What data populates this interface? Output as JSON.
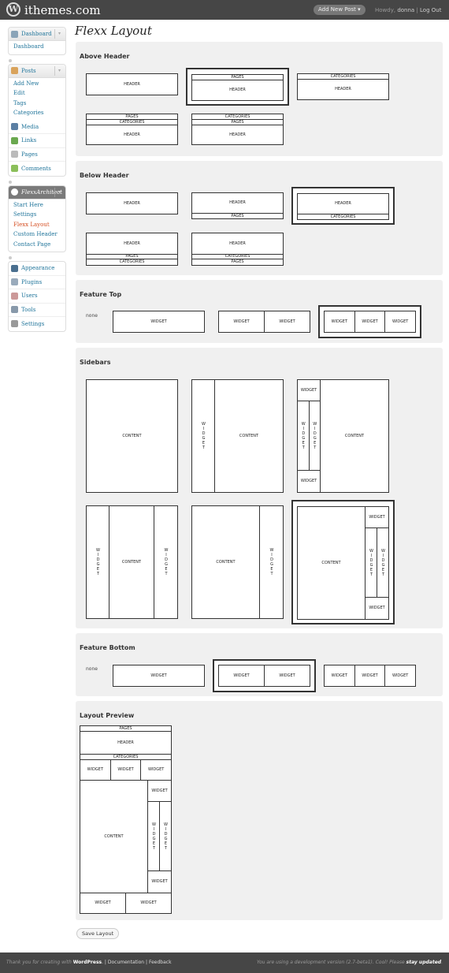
{
  "topbar": {
    "site_name": "ithemes.com",
    "add_new": "Add New Post",
    "howdy": "Howdy,",
    "user": "donna",
    "logout": "Log Out"
  },
  "sidebar": {
    "dashboard": {
      "label": "Dashboard",
      "items": [
        "Dashboard"
      ]
    },
    "posts": {
      "label": "Posts",
      "items": [
        "Add New",
        "Edit",
        "Tags",
        "Categories"
      ]
    },
    "media": "Media",
    "links": "Links",
    "pages": "Pages",
    "comments": "Comments",
    "flexx": {
      "label": "FlexxArchitect",
      "items": [
        "Start Here",
        "Settings",
        "Flexx Layout",
        "Custom Header",
        "Contact Page"
      ]
    },
    "appearance": "Appearance",
    "plugins": "Plugins",
    "users": "Users",
    "tools": "Tools",
    "settings": "Settings"
  },
  "page_title": "Flexx Layout",
  "labels": {
    "header": "HEADER",
    "pages": "PAGES",
    "categories": "CATEGORIES",
    "widget": "WIDGET",
    "content": "CONTENT",
    "none": "none"
  },
  "sections": {
    "above_header": "Above Header",
    "below_header": "Below Header",
    "feature_top": "Feature Top",
    "sidebars": "Sidebars",
    "feature_bottom": "Feature Bottom",
    "layout_preview": "Layout Preview"
  },
  "save_button": "Save Layout",
  "footer": {
    "thanks": "Thank you for creating with",
    "wordpress": "WordPress",
    "documentation": "Documentation",
    "feedback": "Feedback",
    "version_text": "You are using a development version (2.7-beta1). Cool! Please",
    "stay_updated": "stay updated"
  }
}
